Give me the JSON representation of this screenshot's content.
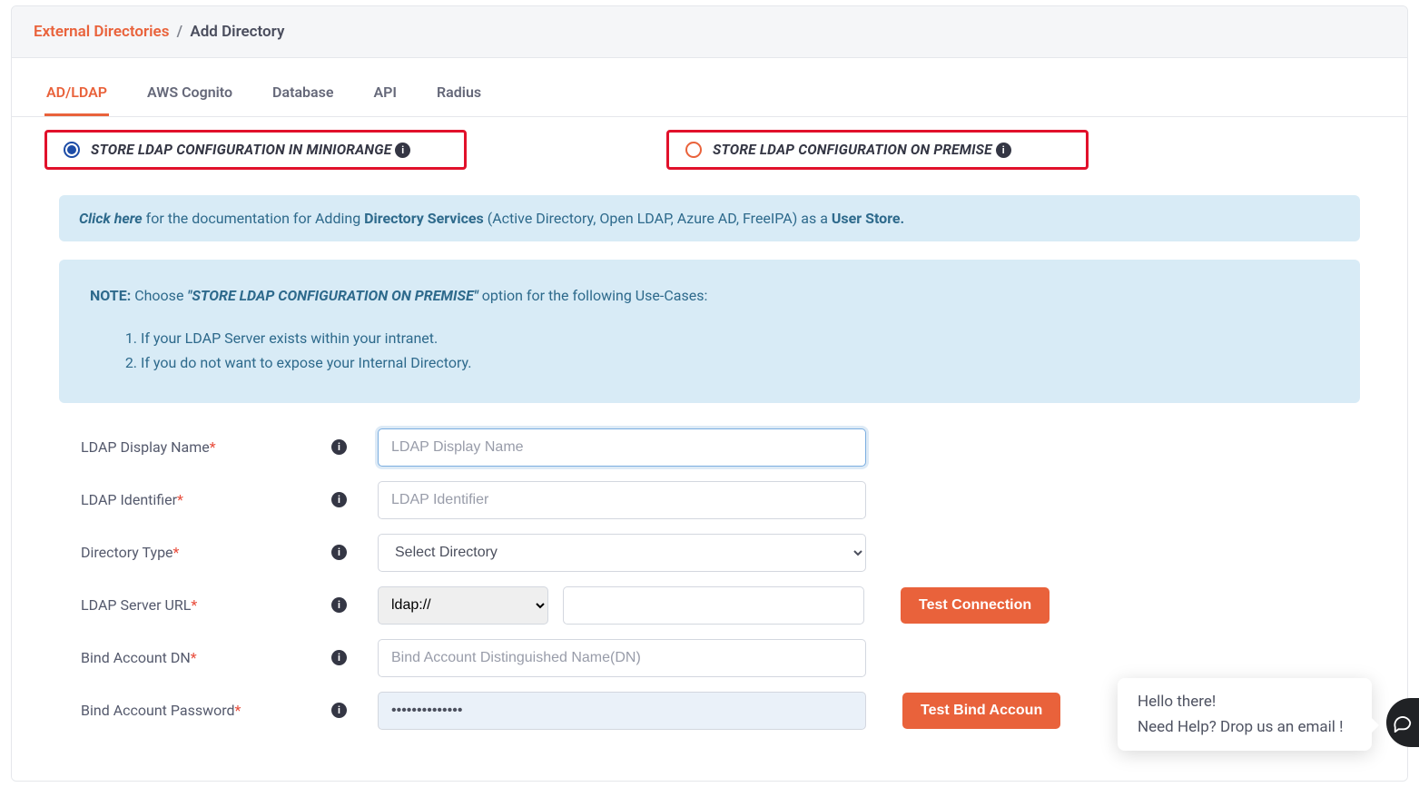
{
  "breadcrumb": {
    "parent": "External Directories",
    "current": "Add Directory"
  },
  "tabs": [
    {
      "label": "AD/LDAP",
      "active": true
    },
    {
      "label": "AWS Cognito"
    },
    {
      "label": "Database"
    },
    {
      "label": "API"
    },
    {
      "label": "Radius"
    }
  ],
  "radios": {
    "miniorange": "STORE LDAP CONFIGURATION IN MINIORANGE",
    "onpremise": "STORE LDAP CONFIGURATION ON PREMISE"
  },
  "doc_panel": {
    "click": "Click here",
    "pre": " for the documentation for Adding ",
    "b1": "Directory Services",
    "mid": " (Active Directory, Open LDAP, Azure AD, FreeIPA) as a ",
    "b2": "User Store."
  },
  "note_panel": {
    "note": "NOTE:",
    "choose": "  Choose ",
    "opt": "\"STORE LDAP CONFIGURATION ON PREMISE\"",
    "tail": " option for the following Use-Cases:",
    "li1": "If your LDAP Server exists within your intranet.",
    "li2": "If you do not want to expose your Internal Directory."
  },
  "form": {
    "display_name": {
      "label": "LDAP Display Name",
      "placeholder": "LDAP Display Name",
      "value": ""
    },
    "identifier": {
      "label": "LDAP Identifier",
      "placeholder": "LDAP Identifier",
      "value": ""
    },
    "dir_type": {
      "label": "Directory Type",
      "placeholder": "Select Directory"
    },
    "server_url": {
      "label": "LDAP Server URL",
      "scheme": "ldap://",
      "value": ""
    },
    "bind_dn": {
      "label": "Bind Account DN",
      "placeholder": "Bind Account Distinguished Name(DN)",
      "value": ""
    },
    "bind_pw": {
      "label": "Bind Account Password",
      "value": "••••••••••••••"
    }
  },
  "buttons": {
    "test_conn": "Test Connection",
    "test_bind": "Test Bind Accoun"
  },
  "chat": {
    "l1": "Hello there!",
    "l2": "Need Help? Drop us an email !"
  }
}
